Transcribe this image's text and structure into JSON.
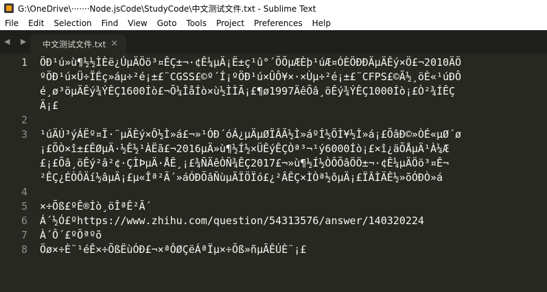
{
  "window": {
    "title": "G:\\OneDrive\\·······Node.jsCode\\StudyCode\\中文测试文件.txt - Sublime Text"
  },
  "menu": [
    "File",
    "Edit",
    "Selection",
    "Find",
    "View",
    "Goto",
    "Tools",
    "Project",
    "Preferences",
    "Help"
  ],
  "tabbar": {
    "nav": "◀ ▶",
    "tab_label": "中文测试文件.txt",
    "close": "×"
  },
  "editor": {
    "lines": [
      {
        "number": "1",
        "wraps": [
          "ÖÐ¹ú»ù¶½½ÌÈë¿ÚµÄÖö³¤ÊÇ±¬·¢Ê¼µÄ¡Ë±ç¹û°´ÕÕµÆÈþ¹úÆ¤ÓÈÖÐÐÄµÄÊý×Ö£¬2010ÄÖ",
          "ºÖÐ¹ú×Ü÷ÏÉç»áµ÷²é¡±£¨CGSS£©º´Í¡ºÖÐ¹ú×ÛÔ¥×·×Ùµ÷²é¡±£¨CFPS£©Ã½¸öÈ«¹úÐÔ",
          "é¸ø³öµÄÊý¾ÝÊÇ1600Íò£¬Õ¼ÎåÍò×ù½ÌÌÃ¡£¶ø1997ÄêÕâ¸öÊý¾ÝÊÇ1000Íò¡£Ò²¾ÍÊÇ",
          "Ä¡£"
        ]
      },
      {
        "number": "2",
        "wraps": [
          ""
        ]
      },
      {
        "number": "3",
        "wraps": [
          "¹úÄÚ³ýÁËº¤Ï·¨µÄÈý×Ô½Ì»á£¬»¹ÓÐ´óÁ¿µÄµØÏÂÃ½Ì»áºÍ½ÖÌ¥½Ì»á¡£ÕâÐ©»ÒÉ«µØ´ø",
          "¡£ÕÒ×î±£ÊØµÄ·½Ê½¹ÀËã£¬2016µÄ»ù¶½Í½×ÜÊýÊÇÒª³¬¹ý6000Íò¡£×î¿äÕÅµÄ¹À¼Æ",
          "£¡£Õâ¸öÊý²â²¢·ÇÌÞµÄ·ÅÊ¸¡£¾ÑÄêÒÑ¾­ÊÇ2017£¬»ù¶½Í½ÒÔÕâÖÖ±¬·¢Ê¼µÄÖö³¤Ê¬",
          "²ÊÇ¿ÉÒÔÄí½âµÄ¡£µ«Îª²Ã´»áÓÐÕâÑùµÄÏÖÏó£¿²ÂÊÇ×ÌÒª½ôµÄ¡£ÏÂÌÄÊ½»õÓÐÒ»á"
        ]
      },
      {
        "number": "4",
        "wraps": [
          ""
        ]
      },
      {
        "number": "5",
        "wraps": [
          "×÷Õß£ºÊ®Íò¸öÎªÊ²Ã´"
        ]
      },
      {
        "number": "6",
        "wraps": [
          "Á´½Ó£ºhttps://www.zhihu.com/question/54313576/answer/140320224"
        ]
      },
      {
        "number": "7",
        "wraps": [
          "À´Ô´£ºÖªºõ"
        ]
      },
      {
        "number": "8",
        "wraps": [
          "Öø×÷È¨¹éÊ×÷ÕßËùÓÐ£¬×ªÔØÇëÁªÏµ×÷Õß»ñµÃÊÚÈ¨¡£"
        ]
      }
    ]
  }
}
